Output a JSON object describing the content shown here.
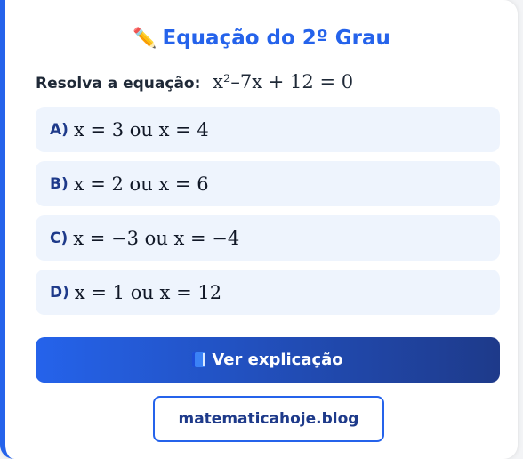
{
  "header": {
    "icon": "pencil-icon",
    "icon_glyph": "✏️",
    "title": "Equação do 2º Grau"
  },
  "question": {
    "label": "Resolva a equação:",
    "equation": "x²–7x + 12 = 0"
  },
  "options": [
    {
      "letter": "A)",
      "text": "x = 3 ou x = 4"
    },
    {
      "letter": "B)",
      "text": "x = 2 ou x = 6"
    },
    {
      "letter": "C)",
      "text": "x = −3 ou x = −4"
    },
    {
      "letter": "D)",
      "text": "x = 1 ou x = 12"
    }
  ],
  "explain_button": {
    "icon": "book-icon",
    "label": "Ver explicação"
  },
  "footer": {
    "link_text": "matematicahoje.blog"
  },
  "colors": {
    "accent": "#2563eb",
    "accent_dark": "#1e3a8a",
    "option_bg": "#eef4fd"
  }
}
